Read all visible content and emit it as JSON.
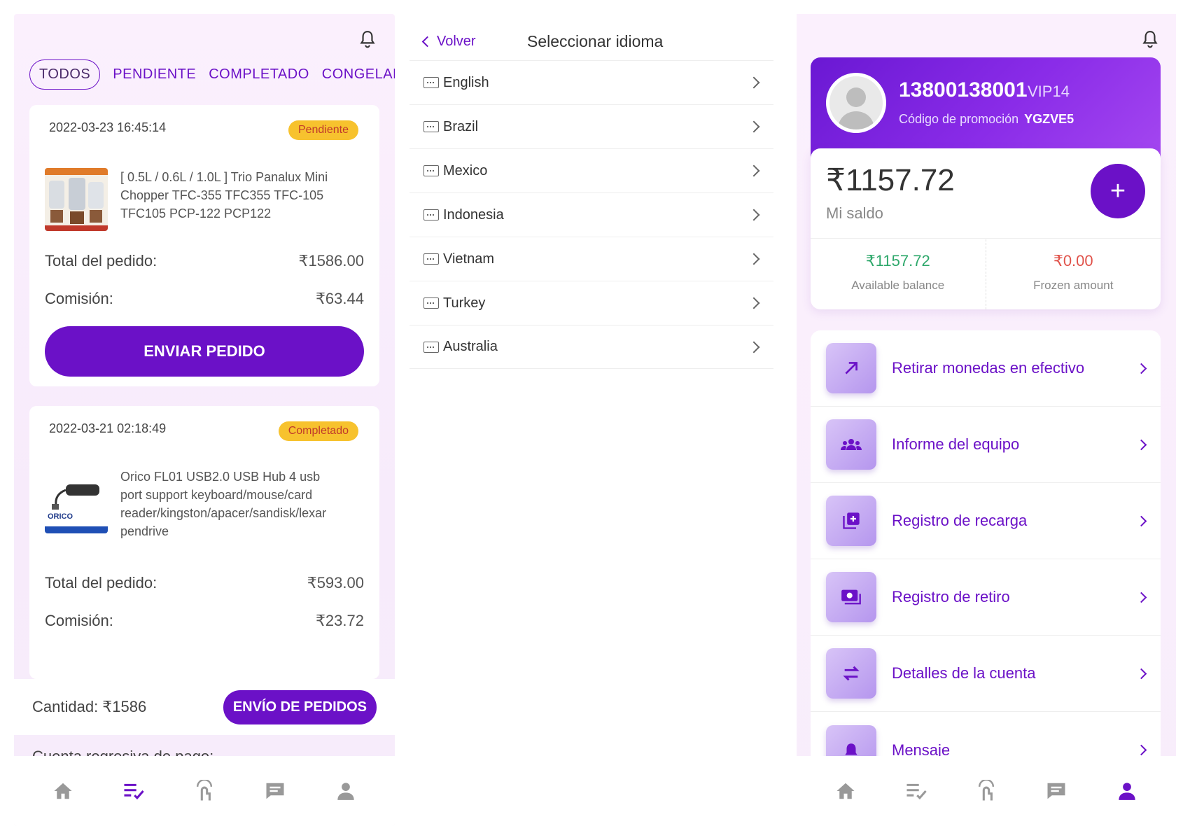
{
  "orders_panel": {
    "tabs": [
      "TODOS",
      "PENDIENTE",
      "COMPLETADO",
      "CONGELANI"
    ],
    "orders": [
      {
        "date": "2022-03-23 16:45:14",
        "status": "Pendiente",
        "title": "[ 0.5L / 0.6L / 1.0L ] Trio Panalux Mini Chopper TFC-355 TFC355 TFC-105 TFC105 PCP-122 PCP122",
        "total_label": "Total del pedido:",
        "total_value": "₹1586.00",
        "commission_label": "Comisión:",
        "commission_value": "₹63.44",
        "button_label": "ENVIAR PEDIDO"
      },
      {
        "date": "2022-03-21 02:18:49",
        "status": "Completado",
        "title": "Orico FL01 USB2.0 USB Hub 4 usb port support keyboard/mouse/card reader/kingston/apacer/sandisk/lexar pendrive",
        "total_label": "Total del pedido:",
        "total_value": "₹593.00",
        "commission_label": "Comisión:",
        "commission_value": "₹23.72"
      }
    ],
    "summary": {
      "quantity_text": "Cantidad: ₹1586",
      "button_label": "ENVÍO DE PEDIDOS",
      "countdown_text": "Cuenta regresiva de pago:"
    },
    "product_logo_text": "ORICO"
  },
  "language_panel": {
    "back_label": "Volver",
    "title": "Seleccionar idioma",
    "languages": [
      "English",
      "Brazil",
      "Mexico",
      "Indonesia",
      "Vietnam",
      "Turkey",
      "Australia"
    ]
  },
  "profile_panel": {
    "phone": "13800138001",
    "vip": "VIP14",
    "promo_label": "Código de promoción",
    "promo_code": "YGZVE5",
    "balance_amount": "₹1157.72",
    "balance_label": "Mi saldo",
    "available_value": "₹1157.72",
    "available_label": "Available balance",
    "frozen_value": "₹0.00",
    "frozen_label": "Frozen amount",
    "menu": [
      {
        "label": "Retirar monedas en efectivo",
        "icon": "arrow-up-right-icon"
      },
      {
        "label": "Informe del equipo",
        "icon": "team-icon"
      },
      {
        "label": "Registro de recarga",
        "icon": "add-stack-icon"
      },
      {
        "label": "Registro de retiro",
        "icon": "cash-icon"
      },
      {
        "label": "Detalles de la cuenta",
        "icon": "swap-icon"
      },
      {
        "label": "Mensaje",
        "icon": "bell-icon"
      }
    ]
  },
  "colors": {
    "accent": "#6b11c7",
    "available_green": "#2ea86b",
    "frozen_red": "#e0524a",
    "badge_yellow": "#f7c22e"
  }
}
